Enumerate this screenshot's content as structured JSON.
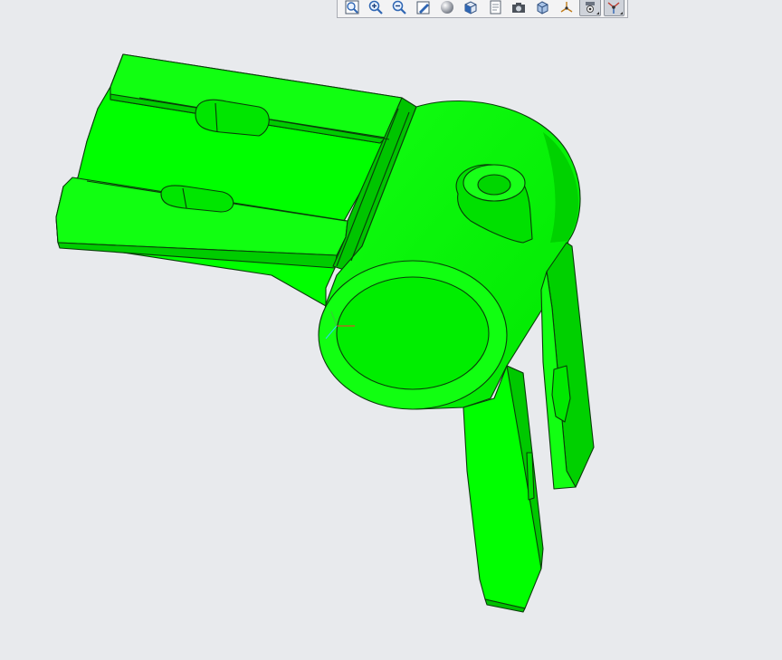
{
  "app": {
    "viewport_background": "#e8eaed",
    "part_color": "#00ff00",
    "edge_color": "#0a3b0a"
  },
  "toolbar": {
    "buttons": [
      {
        "id": "refit",
        "icon": "zoom-fit-icon"
      },
      {
        "id": "zoom-in",
        "icon": "zoom-in-icon"
      },
      {
        "id": "zoom-out",
        "icon": "zoom-out-icon"
      },
      {
        "id": "repaint",
        "icon": "repaint-icon"
      },
      {
        "id": "display-style",
        "icon": "shaded-sphere-icon"
      },
      {
        "id": "saved-views",
        "icon": "view-cube-icon"
      },
      {
        "id": "view-manager",
        "icon": "view-manager-icon"
      },
      {
        "id": "perspective",
        "icon": "camera-icon"
      },
      {
        "id": "section",
        "icon": "section-view-icon"
      },
      {
        "id": "datum-display",
        "icon": "datum-display-icon"
      },
      {
        "id": "annotation-display",
        "icon": "annotation-display-icon",
        "pressed": true
      },
      {
        "id": "spin-center",
        "icon": "spin-center-icon",
        "pressed": true
      }
    ]
  }
}
